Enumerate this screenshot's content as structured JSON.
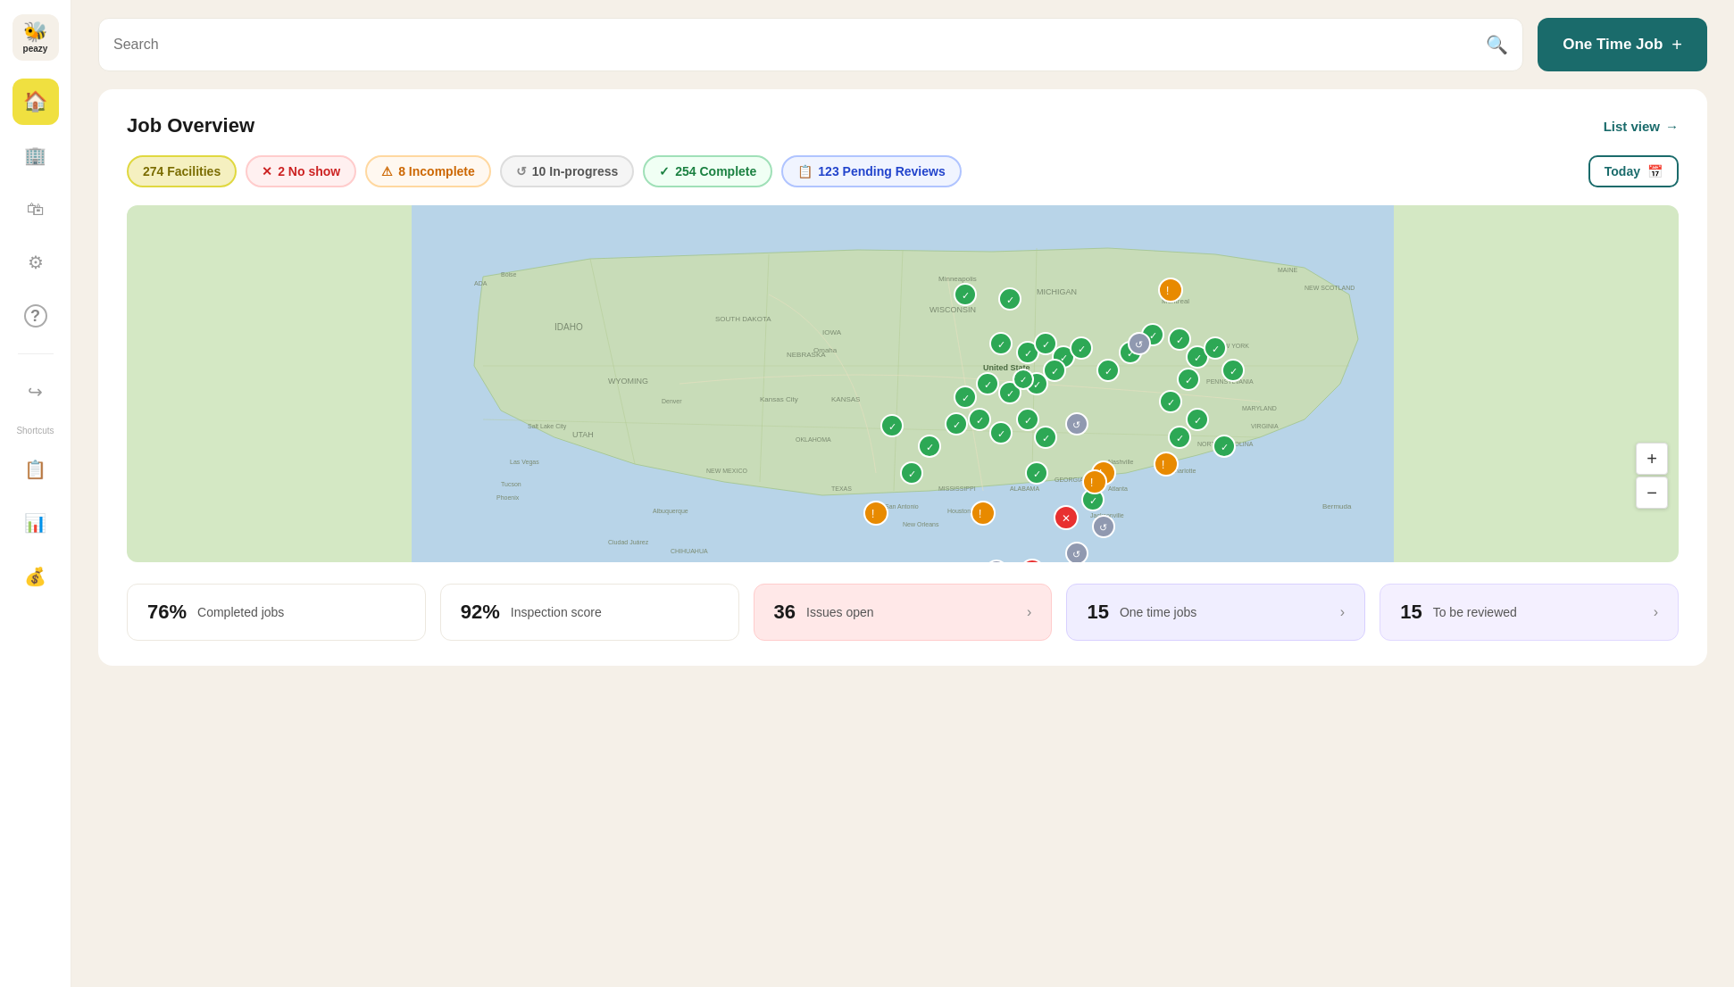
{
  "logo": {
    "icon": "🐝",
    "text": "peazy"
  },
  "nav": {
    "items": [
      {
        "id": "home",
        "icon": "⌂",
        "active": true
      },
      {
        "id": "building",
        "icon": "🏢",
        "active": false
      },
      {
        "id": "bag",
        "icon": "🛍",
        "active": false
      },
      {
        "id": "settings",
        "icon": "⚙",
        "active": false
      },
      {
        "id": "help",
        "icon": "?",
        "active": false
      },
      {
        "id": "logout",
        "icon": "→",
        "active": false
      }
    ],
    "shortcuts_label": "Shortcuts",
    "shortcut_items": [
      {
        "id": "shortcut1",
        "icon": "📋"
      },
      {
        "id": "shortcut2",
        "icon": "📊"
      },
      {
        "id": "shortcut3",
        "icon": "💰"
      }
    ]
  },
  "topbar": {
    "search_placeholder": "Search",
    "one_time_job_label": "One Time Job",
    "one_time_job_icon": "+"
  },
  "overview": {
    "title": "Job Overview",
    "list_view_label": "List view",
    "list_view_arrow": "→"
  },
  "filters": {
    "facilities": {
      "label": "274 Facilities",
      "count": 274
    },
    "no_show": {
      "label": "2 No show",
      "count": 2
    },
    "incomplete": {
      "label": "8 Incomplete",
      "count": 8
    },
    "in_progress": {
      "label": "10 In-progress",
      "count": 10
    },
    "complete": {
      "label": "254 Complete",
      "count": 254
    },
    "pending_reviews": {
      "label": "123 Pending Reviews",
      "count": 123
    },
    "today": {
      "label": "Today"
    }
  },
  "stats": [
    {
      "number": "76%",
      "label": "Completed jobs",
      "style": "default",
      "arrow": false
    },
    {
      "number": "92%",
      "label": "Inspection score",
      "style": "default",
      "arrow": false
    },
    {
      "number": "36",
      "label": "Issues open",
      "style": "pink",
      "arrow": true
    },
    {
      "number": "15",
      "label": "One time jobs",
      "style": "lavender",
      "arrow": true
    },
    {
      "number": "15",
      "label": "To be reviewed",
      "style": "light-lavender",
      "arrow": true
    }
  ]
}
